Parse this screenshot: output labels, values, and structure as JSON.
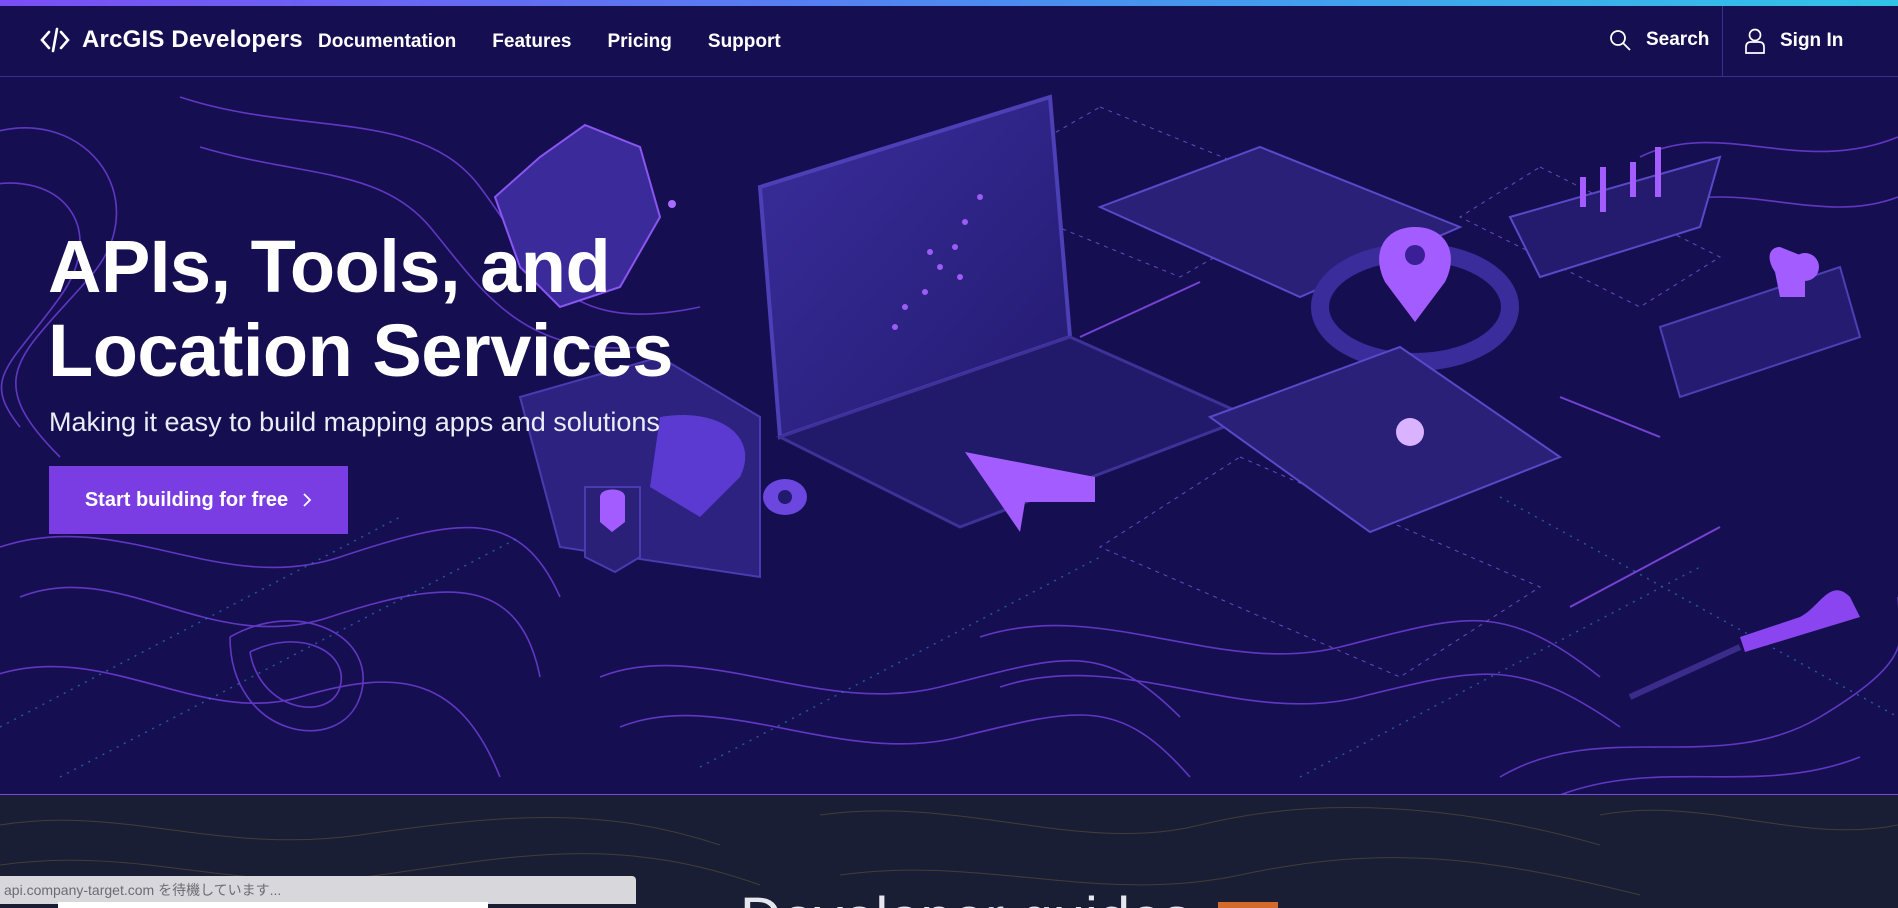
{
  "header": {
    "brand": "ArcGIS Developers",
    "nav": [
      "Documentation",
      "Features",
      "Pricing",
      "Support"
    ],
    "search_label": "Search",
    "signin_label": "Sign In"
  },
  "hero": {
    "title_line1": "APIs, Tools, and",
    "title_line2": "Location Services",
    "subtitle": "Making it easy to build mapping apps and solutions",
    "cta_label": "Start building for free",
    "cta_icon": "chevron-right-icon"
  },
  "below": {
    "heading": "Developer guides"
  },
  "browser_status": {
    "text": "api.company-target.com を待機しています..."
  },
  "colors": {
    "background": "#150f52",
    "accent": "#7a3de3",
    "accent_light": "#9b5cff"
  },
  "icons": [
    "code-brackets-icon",
    "search-icon",
    "user-icon",
    "chevron-right-icon"
  ]
}
